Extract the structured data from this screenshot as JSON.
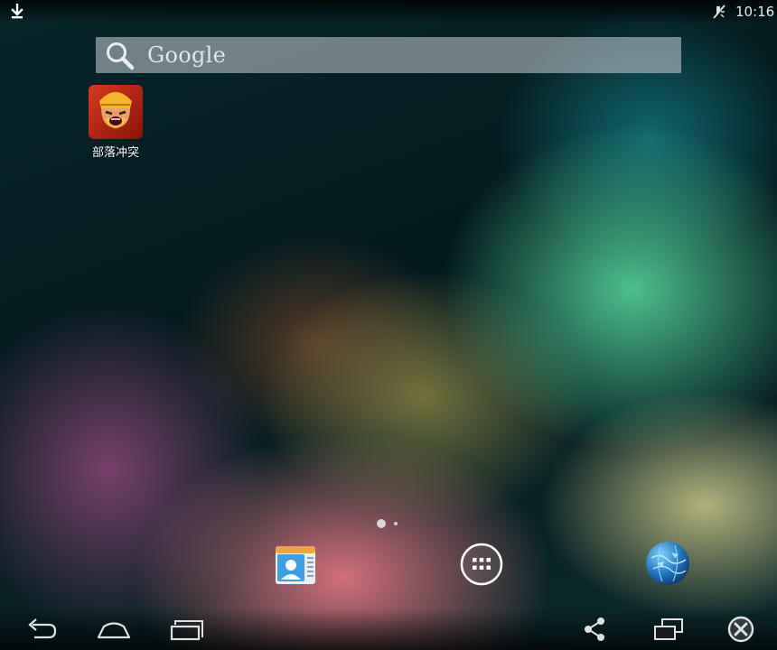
{
  "status_bar": {
    "time": "10:16",
    "left_icons": [
      "download-icon"
    ],
    "right_icons": [
      "mute-icon"
    ]
  },
  "search": {
    "placeholder": "Google",
    "icon": "search-icon"
  },
  "home_screen": {
    "apps": [
      {
        "label": "部落冲突",
        "icon": "clash-of-clans-icon"
      }
    ],
    "page_indicator": {
      "pages": 2,
      "current": 1
    }
  },
  "dock": {
    "items": [
      {
        "name": "contacts",
        "icon": "contacts-icon"
      },
      {
        "name": "app-drawer",
        "icon": "app-drawer-icon"
      },
      {
        "name": "browser",
        "icon": "globe-icon"
      }
    ]
  },
  "nav_bar": {
    "buttons": [
      "back-icon",
      "home-icon",
      "recent-apps-icon",
      "share-icon",
      "screen-rotate-icon",
      "close-icon"
    ]
  },
  "colors": {
    "background_dark": "#062024",
    "search_bar": "#c8d2d7",
    "text": "#ffffff"
  }
}
